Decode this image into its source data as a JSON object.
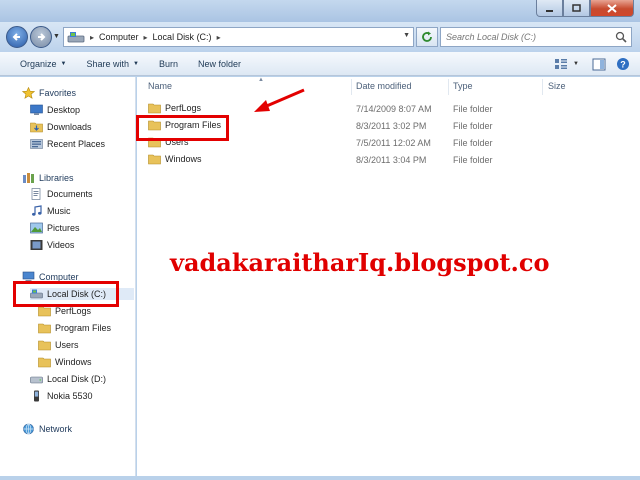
{
  "address": {
    "crumbs": [
      "Computer",
      "Local Disk (C:)"
    ]
  },
  "search": {
    "placeholder": "Search Local Disk (C:)"
  },
  "toolbar": {
    "organize_label": "Organize",
    "share_label": "Share with",
    "burn_label": "Burn",
    "new_folder_label": "New folder"
  },
  "nav": {
    "favorites": "Favorites",
    "desktop": "Desktop",
    "downloads": "Downloads",
    "recent": "Recent Places",
    "libraries": "Libraries",
    "documents": "Documents",
    "music": "Music",
    "pictures": "Pictures",
    "videos": "Videos",
    "computer": "Computer",
    "local_c": "Local Disk (C:)",
    "c_children": [
      "PerfLogs",
      "Program Files",
      "Users",
      "Windows"
    ],
    "local_d": "Local Disk (D:)",
    "nokia": "Nokia 5530",
    "network": "Network"
  },
  "columns": {
    "name": "Name",
    "date": "Date modified",
    "type": "Type",
    "size": "Size"
  },
  "files": [
    {
      "name": "PerfLogs",
      "date": "7/14/2009 8:07 AM",
      "type": "File folder"
    },
    {
      "name": "Program Files",
      "date": "8/3/2011 3:02 PM",
      "type": "File folder"
    },
    {
      "name": "Users",
      "date": "7/5/2011 12:02 AM",
      "type": "File folder"
    },
    {
      "name": "Windows",
      "date": "8/3/2011 3:04 PM",
      "type": "File folder"
    }
  ],
  "watermark": "vadakaraitharIq.blogspot.co",
  "colors": {
    "highlight": "#e30000",
    "folder": "#e8c25a",
    "chrome": "#b9d1ea"
  }
}
